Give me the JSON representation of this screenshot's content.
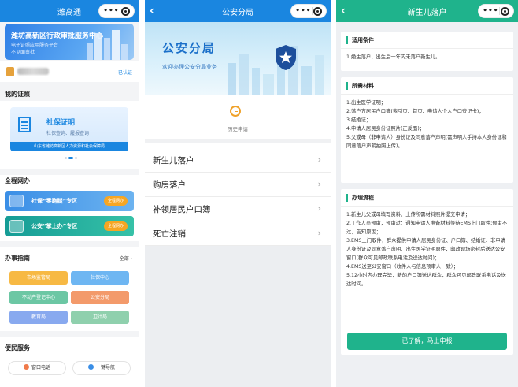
{
  "screen1": {
    "title": "潍高通",
    "banner": {
      "title": "潍坊高新区行政审批服务中心",
      "subtitle1": "电子证照应用服务平台",
      "subtitle2": "不见面审批"
    },
    "user": {
      "verify_label": "已认证"
    },
    "my_license": {
      "heading": "我的证照",
      "card_title": "社保证明",
      "card_subtitle": "社保查询、履报查询",
      "card_footer": "山东省潍坊高新区人力资源和社会保障局"
    },
    "service": {
      "heading": "全程网办",
      "items": [
        {
          "label": "社保“零跑腿”专区",
          "badge": "全程网办"
        },
        {
          "label": "公安“掌上办”专区",
          "badge": "全程网办"
        }
      ]
    },
    "guide": {
      "heading": "办事指南",
      "all_label": "全部 ›",
      "buttons": [
        "市场监管局",
        "社保中心",
        "不动产登记中心",
        "公安分局",
        "教育局",
        "卫计局"
      ]
    },
    "convenience": {
      "heading": "便民服务",
      "buttons": [
        "窗口电话",
        "一键导航"
      ]
    }
  },
  "screen2": {
    "back_icon": "chevron-left-icon",
    "title": "公安分局",
    "hero_title": "公安分局",
    "hero_subtitle": "欢迎办理公安分局业务",
    "history_label": "历史申请",
    "menu": [
      {
        "label": "新生儿落户"
      },
      {
        "label": "购房落户"
      },
      {
        "label": "补领居民户口簿"
      },
      {
        "label": "死亡注销"
      }
    ]
  },
  "screen3": {
    "back_icon": "chevron-left-icon",
    "title": "新生儿落户",
    "sections": [
      {
        "heading": "适用条件",
        "lines": [
          "1.婚生落户，出生后一年内未落户新生儿。"
        ]
      },
      {
        "heading": "所需材料",
        "lines": [
          "1.出生医学证明；",
          "2.落户方居民户口簿(索引页、首页、申请人个人户口登记卡)；",
          "3.结婚证；",
          "4.申请人居民身份证照片(正反面)；",
          "5.父或母（非申请人）身份证及同意落户声明(需声明人手持本人身份证和同意落户声明拍照上传)。"
        ]
      },
      {
        "heading": "办理流程",
        "lines": [
          "1.新生儿父或母填写资料、上传所需材料照片提交申请；",
          "2.工作人员预审，预审过：通知申请人准备材料等待EMS上门取件;预审不过，告知原因；",
          "3.EMS上门取件，群众提供申请人居民身份证、户口簿、结婚证、非申请人身份证及同意落户声明、出生医学证明原件，邮政现场密封后送达公安窗口(群众可见邮政联系电话及送达时间)；",
          "4.EMS送至公安窗口（收件人与信息预审人一致）；",
          "5.12小时内办理完毕，新的户口簿送达群众，群众可见邮政联系电话及送达时间。"
        ]
      }
    ],
    "apply_button": "已了解，马上申报"
  },
  "colors": {
    "screen1_bar": "#1a86e0",
    "screen2_bar": "#1a86e0",
    "screen3_bar": "#1fb38c"
  }
}
